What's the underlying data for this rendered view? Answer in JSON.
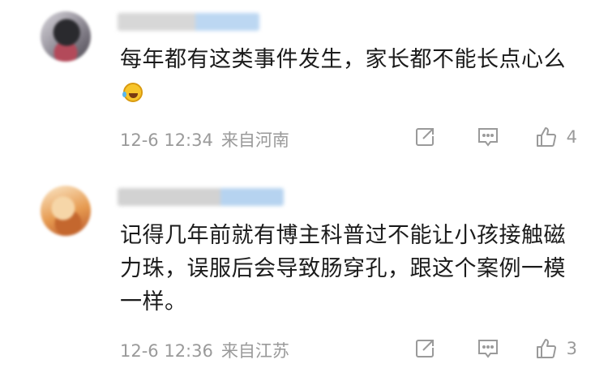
{
  "comments": [
    {
      "text": "每年都有这类事件发生，家长都不能长点心么",
      "emoji": "laugh-cry-emoji",
      "date": "12-6 12:34",
      "location": "来自河南",
      "likes": "4"
    },
    {
      "text": "记得几年前就有博主科普过不能让小孩接触磁力珠，误服后会导致肠穿孔，跟这个案例一模一样。",
      "date": "12-6 12:36",
      "location": "来自江苏",
      "likes": "3"
    }
  ],
  "icons": [
    "share-icon",
    "reply-icon",
    "like-icon"
  ],
  "colors": {
    "meta": "#9a9a9a",
    "text": "#1b1b1b"
  }
}
